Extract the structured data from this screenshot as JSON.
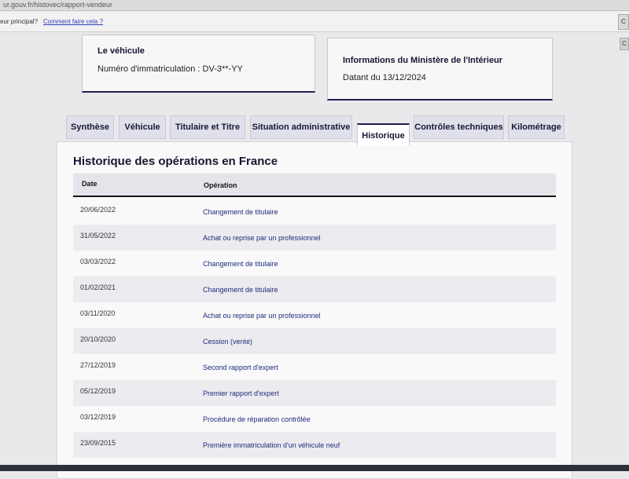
{
  "browser": {
    "url": "ur.gouv.fr/histovec/rapport-vendeur",
    "menu_question": "eur principal?",
    "help_link": "Comment faire cela ?",
    "side_button": "C"
  },
  "vehicle_card": {
    "title": "Le véhicule",
    "registration": "Numéro d'immatriculation : DV-3**-YY"
  },
  "ministry_card": {
    "title": "Informations du Ministère de l'Intérieur",
    "dated": "Datant du 13/12/2024"
  },
  "tabs": [
    {
      "label": "Synthèse",
      "active": false
    },
    {
      "label": "Véhicule",
      "active": false
    },
    {
      "label": "Titulaire et Titre",
      "active": false
    },
    {
      "label": "Situation administrative",
      "active": false
    },
    {
      "label": "Historique",
      "active": true
    },
    {
      "label": "Contrôles techniques",
      "active": false
    },
    {
      "label": "Kilométrage",
      "active": false
    }
  ],
  "history": {
    "title": "Historique des opérations en France",
    "columns": {
      "date": "Date",
      "operation": "Opération"
    },
    "rows": [
      {
        "date": "20/06/2022",
        "operation": "Changement de titulaire"
      },
      {
        "date": "31/05/2022",
        "operation": "Achat ou reprise par un professionnel"
      },
      {
        "date": "03/03/2022",
        "operation": "Changement de titulaire"
      },
      {
        "date": "01/02/2021",
        "operation": "Changement de titulaire"
      },
      {
        "date": "03/11/2020",
        "operation": "Achat ou reprise par un professionnel"
      },
      {
        "date": "20/10/2020",
        "operation": "Cession (vente)"
      },
      {
        "date": "27/12/2019",
        "operation": "Second rapport d'expert"
      },
      {
        "date": "05/12/2019",
        "operation": "Premier rapport d'expert"
      },
      {
        "date": "03/12/2019",
        "operation": "Procédure de réparation contrôlée"
      },
      {
        "date": "23/09/2015",
        "operation": "Première immatriculation d'un véhicule neuf"
      }
    ]
  },
  "colors": {
    "accent": "#1e1e50",
    "link": "#2a3fb8",
    "operation_text": "#1f2a7a"
  }
}
